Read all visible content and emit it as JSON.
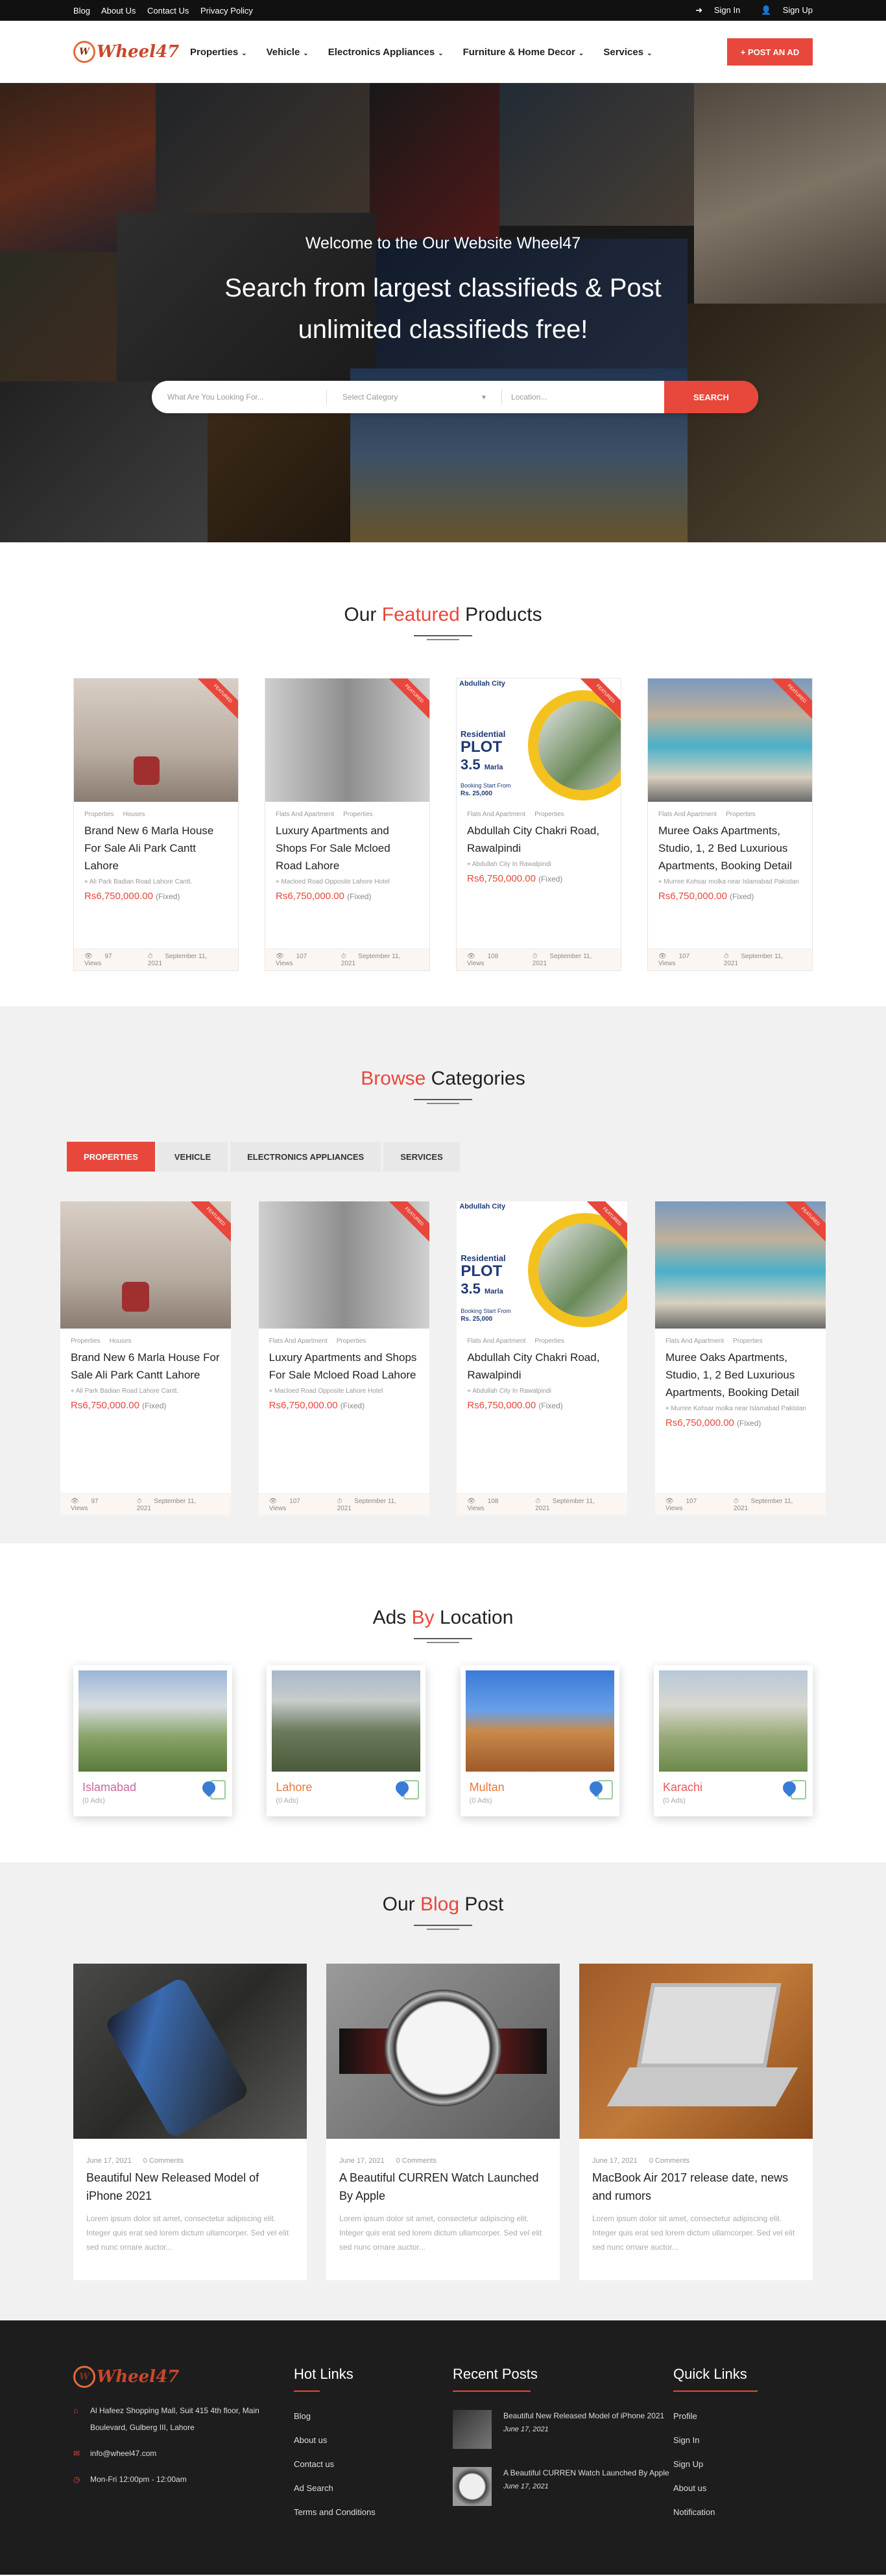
{
  "topbar": {
    "links": [
      "Blog",
      "About Us",
      "Contact Us",
      "Privacy Policy"
    ],
    "sign_in": "Sign In",
    "sign_up": "Sign Up"
  },
  "header": {
    "logo_text": "Wheel47",
    "nav": [
      "Properties",
      "Vehicle",
      "Electronics Appliances",
      "Furniture & Home Decor",
      "Services"
    ],
    "post_ad": "POST AN AD"
  },
  "hero": {
    "welcome": "Welcome to the Our Website Wheel47",
    "headline_1": "Search from largest classifieds & Post",
    "headline_2": "unlimited classifieds free!",
    "search_placeholder": "What Are You Looking For...",
    "category_placeholder": "Select Category",
    "location_placeholder": "Location...",
    "search_button": "SEARCH"
  },
  "featured": {
    "title_pre": "Our ",
    "title_accent": "Featured",
    "title_post": " Products",
    "ribbon": "FEATURED",
    "items": [
      {
        "cat1": "Properties",
        "cat2": "Houses",
        "title": "Brand New 6 Marla House For Sale Ali Park Cantt Lahore",
        "location": "Ali Park Badian Road Lahore Cantt.",
        "price": "Rs6,750,000.00",
        "price_note": "(Fixed)",
        "views": "97 Views",
        "date": "September 11, 2021"
      },
      {
        "cat1": "Flats And Apartment",
        "cat2": "Properties",
        "title": "Luxury Apartments and Shops For Sale Mcloed Road Lahore",
        "location": "Macloed Road Opposite Lahore Hotel",
        "price": "Rs6,750,000.00",
        "price_note": "(Fixed)",
        "views": "107 Views",
        "date": "September 11, 2021"
      },
      {
        "cat1": "Flats And Apartment",
        "cat2": "Properties",
        "title": "Abdullah City Chakri Road, Rawalpindi",
        "location": "Abdullah City In Rawalpindi",
        "price": "Rs6,750,000.00",
        "price_note": "(Fixed)",
        "views": "108 Views",
        "date": "September 11, 2021"
      },
      {
        "cat1": "Flats And Apartment",
        "cat2": "Properties",
        "title": "Muree Oaks Apartments, Studio, 1, 2 Bed Luxurious Apartments, Booking Detail",
        "location": "Murree Kohsar molka near Islamabad Pakistan",
        "price": "Rs6,750,000.00",
        "price_note": "(Fixed)",
        "views": "107 Views",
        "date": "September 11, 2021"
      }
    ]
  },
  "browse": {
    "title_accent": "Browse",
    "title_post": " Categories",
    "tabs": [
      "PROPERTIES",
      "VEHICLE",
      "ELECTRONICS APPLIANCES",
      "SERVICES"
    ]
  },
  "plot_card": {
    "brand": "Abdullah City",
    "line1": "Residential",
    "line2": "PLOT",
    "line3": "3.5",
    "line3b": "Marla",
    "line4": "Booking Start From",
    "line5": "Rs. 25,000"
  },
  "locations": {
    "title_pre": "Ads ",
    "title_accent": "By",
    "title_post": " Location",
    "items": [
      {
        "name": "Islamabad",
        "count": "(0 Ads)"
      },
      {
        "name": "Lahore",
        "count": "(0 Ads)"
      },
      {
        "name": "Multan",
        "count": "(0 Ads)"
      },
      {
        "name": "Karachi",
        "count": "(0 Ads)"
      }
    ]
  },
  "blog": {
    "title_pre": "Our ",
    "title_accent": "Blog",
    "title_post": " Post",
    "posts": [
      {
        "date": "June 17, 2021",
        "comments": "0 Comments",
        "title": "Beautiful New Released Model of iPhone 2021",
        "excerpt": "Lorem ipsum dolor sit amet, consectetur adipiscing elit. Integer quis erat sed lorem dictum ullamcorper. Sed vel elit sed nunc ornare auctor..."
      },
      {
        "date": "June 17, 2021",
        "comments": "0 Comments",
        "title": "A Beautiful CURREN Watch Launched By Apple",
        "excerpt": "Lorem ipsum dolor sit amet, consectetur adipiscing elit. Integer quis erat sed lorem dictum ullamcorper. Sed vel elit sed nunc ornare auctor..."
      },
      {
        "date": "June 17, 2021",
        "comments": "0 Comments",
        "title": "MacBook Air 2017 release date, news and rumors",
        "excerpt": "Lorem ipsum dolor sit amet, consectetur adipiscing elit. Integer quis erat sed lorem dictum ullamcorper. Sed vel elit sed nunc ornare auctor..."
      }
    ]
  },
  "footer": {
    "logo_text": "Wheel47",
    "address": "Al Hafeez Shopping Mall, Suit 415 4th floor, Main Boulevard, Gulberg III, Lahore",
    "email": "info@wheel47.com",
    "hours": "Mon-Fri 12:00pm - 12:00am",
    "hot_links_title": "Hot Links",
    "hot_links": [
      "Blog",
      "About us",
      "Contact us",
      "Ad Search",
      "Terms and Conditions"
    ],
    "recent_title": "Recent Posts",
    "recent": [
      {
        "title": "Beautiful New Released Model of iPhone 2021",
        "date": "June 17, 2021"
      },
      {
        "title": "A Beautiful CURREN Watch Launched By Apple",
        "date": "June 17, 2021"
      }
    ],
    "quick_title": "Quick Links",
    "quick_links": [
      "Profile",
      "Sign In",
      "Sign Up",
      "About us",
      "Notification"
    ]
  },
  "colors": {
    "accent": "#e8473b",
    "footer_bg": "#1d1d1d",
    "section_bg": "#f1f1f1"
  }
}
